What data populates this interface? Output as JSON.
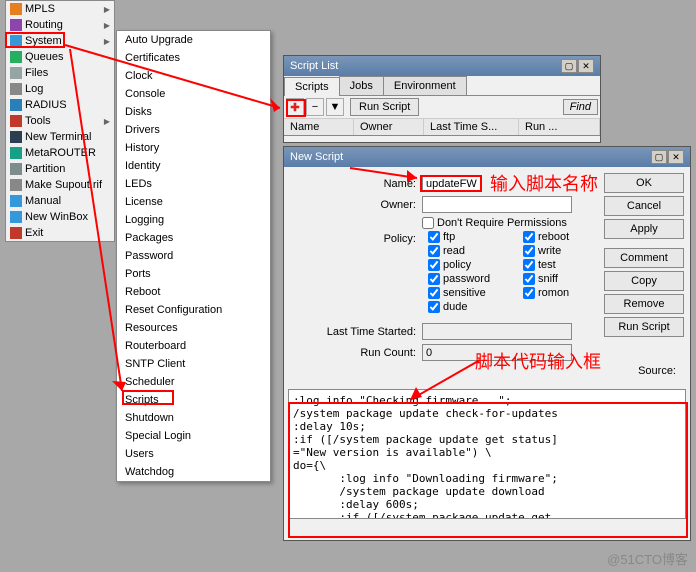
{
  "sidebar": {
    "items": [
      {
        "label": "MPLS",
        "icon": "#e67e22",
        "arrow": true
      },
      {
        "label": "Routing",
        "icon": "#8e44ad",
        "arrow": true
      },
      {
        "label": "System",
        "icon": "#3498db",
        "arrow": true
      },
      {
        "label": "Queues",
        "icon": "#27ae60"
      },
      {
        "label": "Files",
        "icon": "#95a5a6"
      },
      {
        "label": "Log",
        "icon": "#888"
      },
      {
        "label": "RADIUS",
        "icon": "#2980b9"
      },
      {
        "label": "Tools",
        "icon": "#c0392b",
        "arrow": true
      },
      {
        "label": "New Terminal",
        "icon": "#2c3e50"
      },
      {
        "label": "MetaROUTER",
        "icon": "#16a085"
      },
      {
        "label": "Partition",
        "icon": "#7f8c8d"
      },
      {
        "label": "Make Supout.rif",
        "icon": "#888"
      },
      {
        "label": "Manual",
        "icon": "#3498db"
      },
      {
        "label": "New WinBox",
        "icon": "#3498db"
      },
      {
        "label": "Exit",
        "icon": "#c0392b"
      }
    ]
  },
  "submenu": {
    "items": [
      "Auto Upgrade",
      "Certificates",
      "Clock",
      "Console",
      "Disks",
      "Drivers",
      "History",
      "Identity",
      "LEDs",
      "License",
      "Logging",
      "Packages",
      "Password",
      "Ports",
      "Reboot",
      "Reset Configuration",
      "Resources",
      "Routerboard",
      "SNTP Client",
      "Scheduler",
      "Scripts",
      "Shutdown",
      "Special Login",
      "Users",
      "Watchdog"
    ]
  },
  "scriptList": {
    "title": "Script List",
    "tabs": [
      "Scripts",
      "Jobs",
      "Environment"
    ],
    "runBtn": "Run Script",
    "findBtn": "Find",
    "cols": [
      "Name",
      "Owner",
      "Last Time S...",
      "Run ..."
    ]
  },
  "newScript": {
    "title": "New Script",
    "labels": {
      "name": "Name:",
      "owner": "Owner:",
      "policy": "Policy:",
      "lastTime": "Last Time Started:",
      "runCount": "Run Count:",
      "source": "Source:",
      "dontRequire": "Don't Require Permissions"
    },
    "values": {
      "name": "updateFW",
      "owner": "",
      "runCount": "0"
    },
    "policies": [
      [
        "ftp",
        "reboot"
      ],
      [
        "read",
        "write"
      ],
      [
        "policy",
        "test"
      ],
      [
        "password",
        "sniff"
      ],
      [
        "sensitive",
        "romon"
      ],
      [
        "dude",
        ""
      ]
    ],
    "buttons": {
      "ok": "OK",
      "cancel": "Cancel",
      "apply": "Apply",
      "comment": "Comment",
      "copy": "Copy",
      "remove": "Remove",
      "run": "Run Script"
    },
    "source": ":log info \"Checking firmware...\";\n/system package update check-for-updates\n:delay 10s;\n:if ([/system package update get status]\n=\"New version is available\") \\\ndo={\\\n       :log info \"Downloading firmware\";\n       /system package update download\n       :delay 600s;\n       :if ([/system package update get"
  },
  "annotations": {
    "nameHint": "输入脚本名称",
    "sourceHint": "脚本代码输入框"
  },
  "watermark": "@51CTO博客"
}
